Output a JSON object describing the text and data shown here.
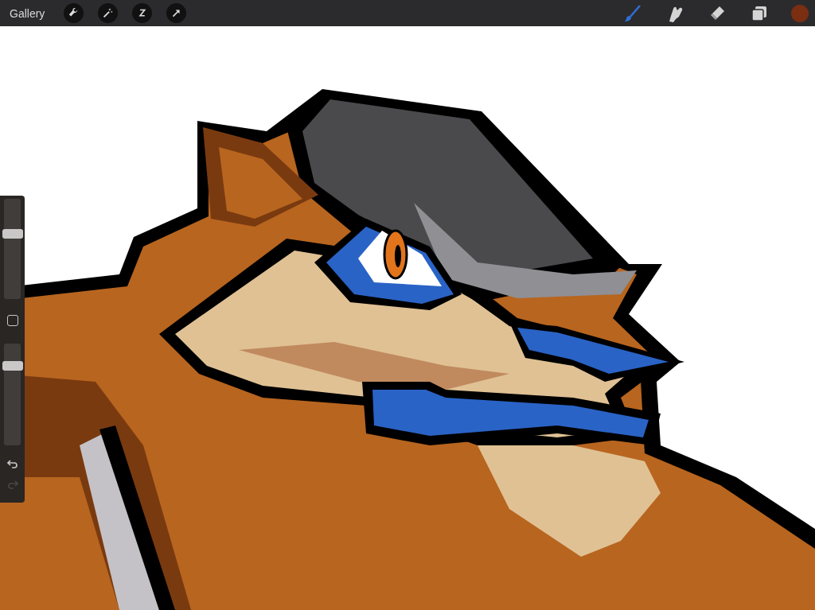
{
  "toolbar": {
    "gallery": "Gallery",
    "actions": [
      {
        "kind": "wrench"
      },
      {
        "kind": "wand"
      },
      {
        "kind": "selection"
      },
      {
        "kind": "transform"
      }
    ],
    "tools": [
      {
        "kind": "brush",
        "selected": true
      },
      {
        "kind": "smudge",
        "selected": false
      },
      {
        "kind": "eraser",
        "selected": false
      },
      {
        "kind": "layers",
        "selected": false
      }
    ],
    "color": "#7a2e12"
  },
  "sidebar": {
    "brush_size": {
      "level": 0.67
    },
    "opacity": {
      "level": 0.81
    },
    "undo": {
      "disabled": false
    },
    "redo": {
      "disabled": true
    }
  }
}
